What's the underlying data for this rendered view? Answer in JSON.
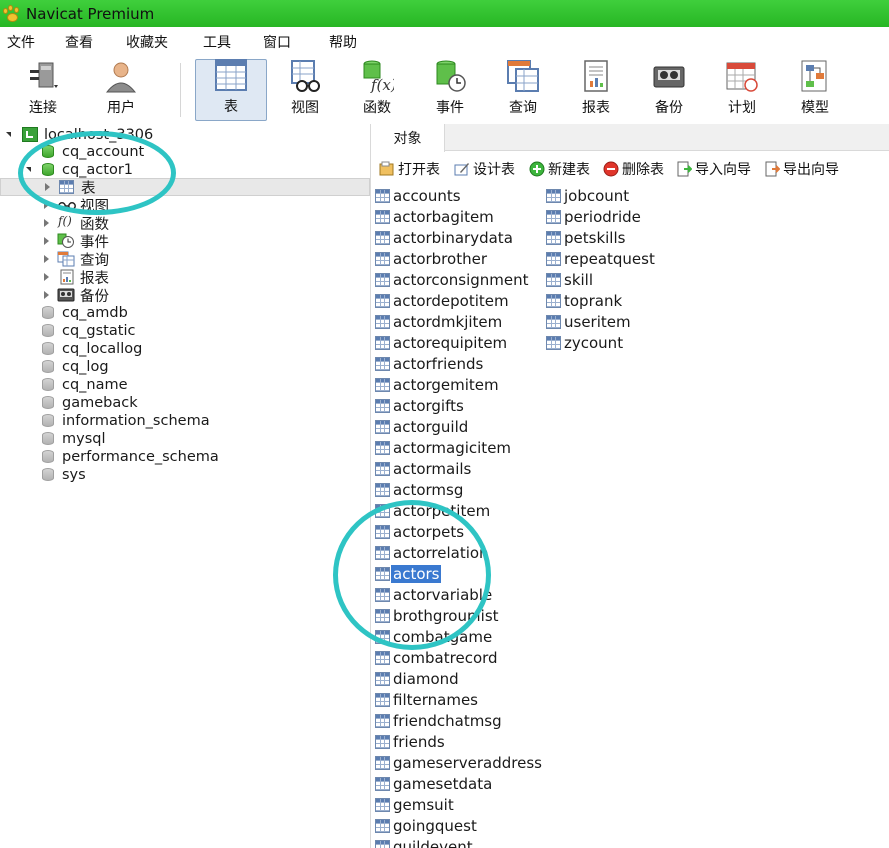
{
  "window": {
    "title": "Navicat Premium"
  },
  "menu": [
    "文件",
    "查看",
    "收藏夹",
    "工具",
    "窗口",
    "帮助"
  ],
  "toolbar": {
    "connect": "连接",
    "user": "用户",
    "table": "表",
    "view": "视图",
    "function": "函数",
    "event": "事件",
    "query": "查询",
    "report": "报表",
    "backup": "备份",
    "schedule": "计划",
    "model": "模型"
  },
  "tree": {
    "connection": "localhost_3306",
    "databases": [
      "cq_account",
      "cq_actor1",
      "cq_amdb",
      "cq_gstatic",
      "cq_locallog",
      "cq_log",
      "cq_name",
      "gameback",
      "information_schema",
      "mysql",
      "performance_schema",
      "sys"
    ],
    "open_db_children": [
      "表",
      "视图",
      "函数",
      "事件",
      "查询",
      "报表",
      "备份"
    ]
  },
  "objects": {
    "tab": "对象",
    "actions": {
      "open_table": "打开表",
      "design_table": "设计表",
      "new_table": "新建表",
      "delete_table": "删除表",
      "import_wizard": "导入向导",
      "export_wizard": "导出向导"
    },
    "column1": [
      "accounts",
      "actorbagitem",
      "actorbinarydata",
      "actorbrother",
      "actorconsignment",
      "actordepotitem",
      "actordmkjitem",
      "actorequipitem",
      "actorfriends",
      "actorgemitem",
      "actorgifts",
      "actorguild",
      "actormagicitem",
      "actormails",
      "actormsg",
      "actorpetitem",
      "actorpets",
      "actorrelation",
      "actors",
      "actorvariable",
      "brothgrouplist",
      "combatgame",
      "combatrecord",
      "diamond",
      "filternames",
      "friendchatmsg",
      "friends",
      "gameserveraddress",
      "gamesetdata",
      "gemsuit",
      "goingquest",
      "guildevent"
    ],
    "column2": [
      "jobcount",
      "periodride",
      "petskills",
      "repeatquest",
      "skill",
      "toprank",
      "useritem",
      "zycount"
    ],
    "selected": "actors"
  },
  "colors": {
    "titlebar": "#27b624",
    "selection": "#3a79d0",
    "annotation": "#2ec4c4"
  }
}
